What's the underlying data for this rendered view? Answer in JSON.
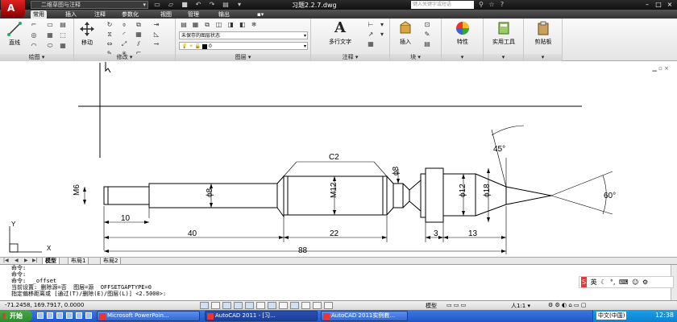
{
  "title_bar": {
    "workspace": "二维草图与注释",
    "window_title": "习题2.2.7.dwg",
    "search_placeholder": "键入关键字或短语"
  },
  "menu_tabs": [
    "常用",
    "插入",
    "注释",
    "参数化",
    "视图",
    "管理",
    "输出"
  ],
  "ribbon": {
    "draw": {
      "line_label": "直线",
      "title": "绘图"
    },
    "modify": {
      "move_label": "移动",
      "title": "修改"
    },
    "layers": {
      "state_value": "未保存的图层状态",
      "layer_value": "0",
      "title": "图层"
    },
    "annotation": {
      "mtext_label": "多行文字",
      "title": "注释"
    },
    "block": {
      "insert_label": "插入",
      "title": "块"
    },
    "properties": {
      "label": "特性"
    },
    "utilities": {
      "label": "实用工具"
    },
    "clipboard": {
      "label": "剪贴板"
    }
  },
  "drawing": {
    "dims": {
      "m6": "M6",
      "d8_left": "ϕ8",
      "c2": "C2",
      "m12": "M12",
      "d8_top": "ϕ8",
      "d12": "ϕ12",
      "d18": "ϕ18",
      "angle45": "45°",
      "angle60": "60°",
      "len10": "10",
      "len40": "40",
      "len22": "22",
      "len3": "3",
      "len13": "13",
      "len88": "88"
    },
    "ucs_x": "X",
    "ucs_y": "Y"
  },
  "layout_tabs": [
    "模型",
    "布局1",
    "布局2"
  ],
  "command_lines": [
    "命令:",
    "命令:",
    "命令:  _offset",
    "当前设置: 删除源=否  图层=源  OFFSETGAPTYPE=0",
    "指定偏移距离或 [通过(T)/删除(E)/图层(L)] <2.5000>:"
  ],
  "ime": {
    "label": "英"
  },
  "status_bar": {
    "coords": "-71.2458, 169.7917, 0.0000",
    "model_label": "模型",
    "scale": "1:1"
  },
  "taskbar": {
    "start_label": "开始",
    "tasks": [
      "Microsoft PowerPoin...",
      "AutoCAD 2011 - [习...",
      "AutoCAD 2011实例教..."
    ],
    "language": "中文(中国)",
    "clock": "12:38"
  }
}
